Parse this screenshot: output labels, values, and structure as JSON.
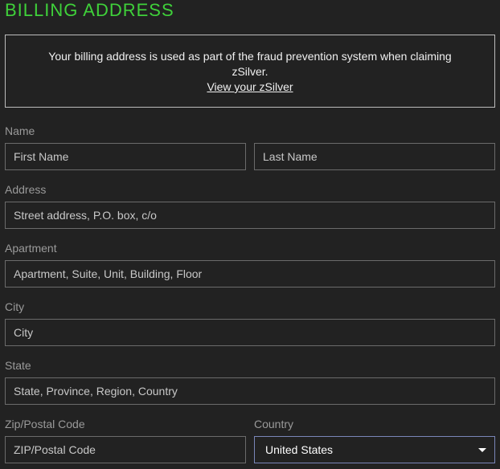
{
  "title": "BILLING ADDRESS",
  "notice": {
    "message": "Your billing address is used as part of the fraud prevention system when claiming zSilver.",
    "link": "View your zSilver"
  },
  "form": {
    "name_label": "Name",
    "first_name_placeholder": "First Name",
    "last_name_placeholder": "Last Name",
    "address_label": "Address",
    "address_placeholder": "Street address, P.O. box, c/o",
    "apartment_label": "Apartment",
    "apartment_placeholder": "Apartment, Suite, Unit, Building, Floor",
    "city_label": "City",
    "city_placeholder": "City",
    "state_label": "State",
    "state_placeholder": "State, Province, Region, Country",
    "zip_label": "Zip/Postal Code",
    "zip_placeholder": "ZIP/Postal Code",
    "country_label": "Country",
    "country_value": "United States"
  },
  "colors": {
    "accent": "#3fd13a",
    "background": "#222222",
    "field_border": "#6b6b6b",
    "focus_border": "#7a86b8"
  },
  "icons": {
    "country_dropdown": "caret-down-icon"
  }
}
